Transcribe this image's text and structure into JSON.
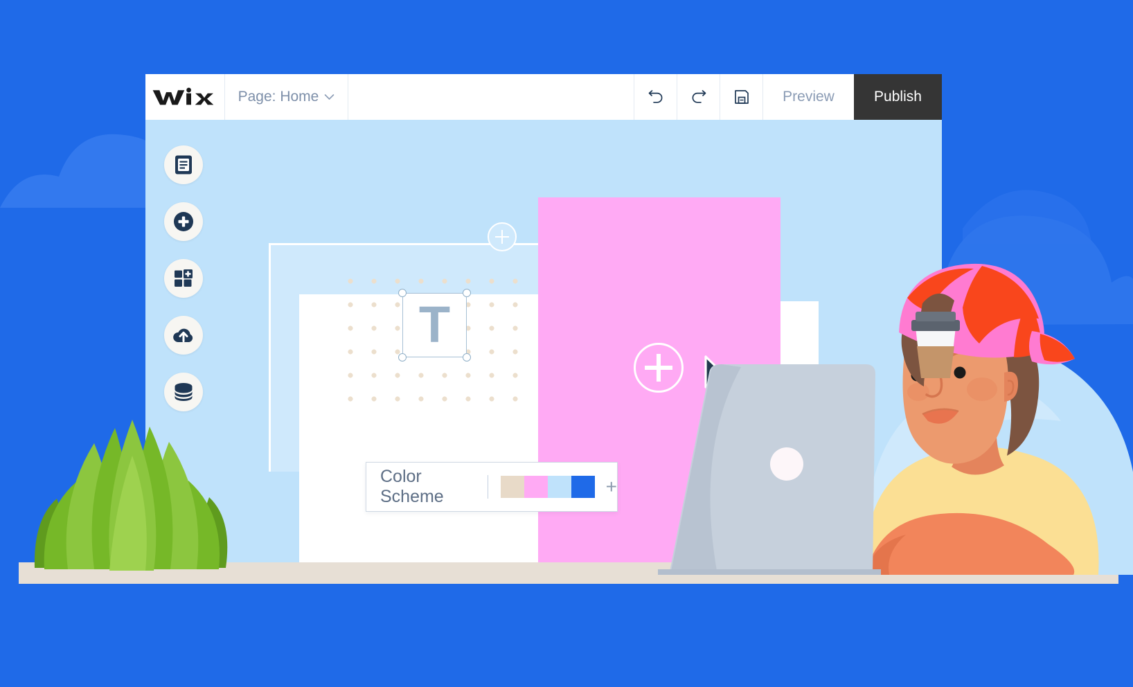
{
  "app": {
    "name": "Wix Editor",
    "brand_logo_text": "WiX"
  },
  "toolbar": {
    "page_selector_label": "Page: Home",
    "page_selector_caret": "chevron-down-icon",
    "undo_label": "undo-icon",
    "redo_label": "redo-icon",
    "save_label": "save-icon",
    "preview_label": "Preview",
    "publish_label": "Publish",
    "publish_bg": "#353535",
    "text_color": "#8a9bb4"
  },
  "sidebar": {
    "items": [
      {
        "name": "pages",
        "icon": "document-pages-icon"
      },
      {
        "name": "add",
        "icon": "plus-circle-icon"
      },
      {
        "name": "apps",
        "icon": "app-grid-plus-icon"
      },
      {
        "name": "upload",
        "icon": "cloud-upload-icon"
      },
      {
        "name": "database",
        "icon": "database-stack-icon"
      }
    ],
    "button_bg": "#f7f6f2",
    "icon_color": "#1f3855"
  },
  "canvas": {
    "background": "#bfe2fb",
    "sections": [
      {
        "name": "light-blue-section",
        "color": "#cfe9fc"
      },
      {
        "name": "white-page-section",
        "color": "#ffffff"
      },
      {
        "name": "pink-strip-section",
        "color": "#ffaaf4"
      },
      {
        "name": "pale-blue-section",
        "color": "#e8f5fe"
      }
    ],
    "add_section_button": "+",
    "add_element_button": "+",
    "selected_element": {
      "name": "text-element",
      "glyph": "T",
      "glyph_color": "#9bb3c9",
      "outline_color": "#a6bfd4",
      "handles": 4
    },
    "dot_grid_color": "#ecdfcd"
  },
  "color_scheme": {
    "label": "Color Scheme",
    "add_label": "+",
    "swatches": [
      {
        "name": "beige",
        "hex": "#e8dac8"
      },
      {
        "name": "pink",
        "hex": "#ffaaf4"
      },
      {
        "name": "light-blue",
        "hex": "#bfe2fb"
      },
      {
        "name": "blue",
        "hex": "#1f6ae8"
      }
    ]
  },
  "illustration": {
    "background_color": "#1f6ae8",
    "cloud_color": "#3379ee",
    "desk_color": "#e7dfd5",
    "plant": {
      "name": "succulent-plant",
      "leaf_light": "#8cc63f",
      "leaf_mid": "#76b828",
      "leaf_dark": "#5f9b1e"
    },
    "person": {
      "name": "person-at-laptop",
      "skin": "#ec9a6e",
      "skin_shade": "#e4845c",
      "hair": "#7c5440",
      "shirt": "#fbdf94",
      "cap_pink": "#ff7bd1",
      "cap_red": "#f9461c"
    },
    "laptop": {
      "name": "laptop",
      "body": "#b8c3d1",
      "lid": "#c6d0dc",
      "logo": "#fdf6f9"
    },
    "coffee_cup": {
      "name": "coffee-cup",
      "lid": "#5b636e",
      "cup": "#f6f7f9",
      "sleeve": "#c4956a"
    }
  },
  "cursor": {
    "name": "mouse-pointer",
    "fill": "#22384d",
    "stroke": "#ffffff"
  }
}
